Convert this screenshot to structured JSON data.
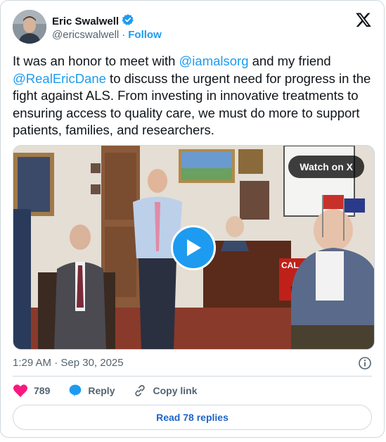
{
  "author": {
    "name": "Eric Swalwell",
    "handle": "@ericswalwell",
    "separator": "·",
    "follow_label": "Follow"
  },
  "tweet": {
    "line1_a": "It was an honor to meet with ",
    "mention1": "@iamalsorg",
    "line1_b": " and my friend",
    "mention2": "@RealEricDane",
    "rest": " to discuss the urgent need for progress in the fight against ALS. From investing in innovative treatments to ensuring access to quality care, we must do more to support patients, families, and researchers."
  },
  "media": {
    "watch_label": "Watch on X",
    "sign_text": "CAL"
  },
  "timestamp": "1:29 AM · Sep 30, 2025",
  "actions": {
    "likes_count": "789",
    "reply_label": "Reply",
    "copy_label": "Copy link"
  },
  "read_replies_label": "Read 78 replies",
  "colors": {
    "accent": "#1d9bf0",
    "like": "#f91880",
    "text_secondary": "#536471",
    "border": "#cfd9de"
  }
}
